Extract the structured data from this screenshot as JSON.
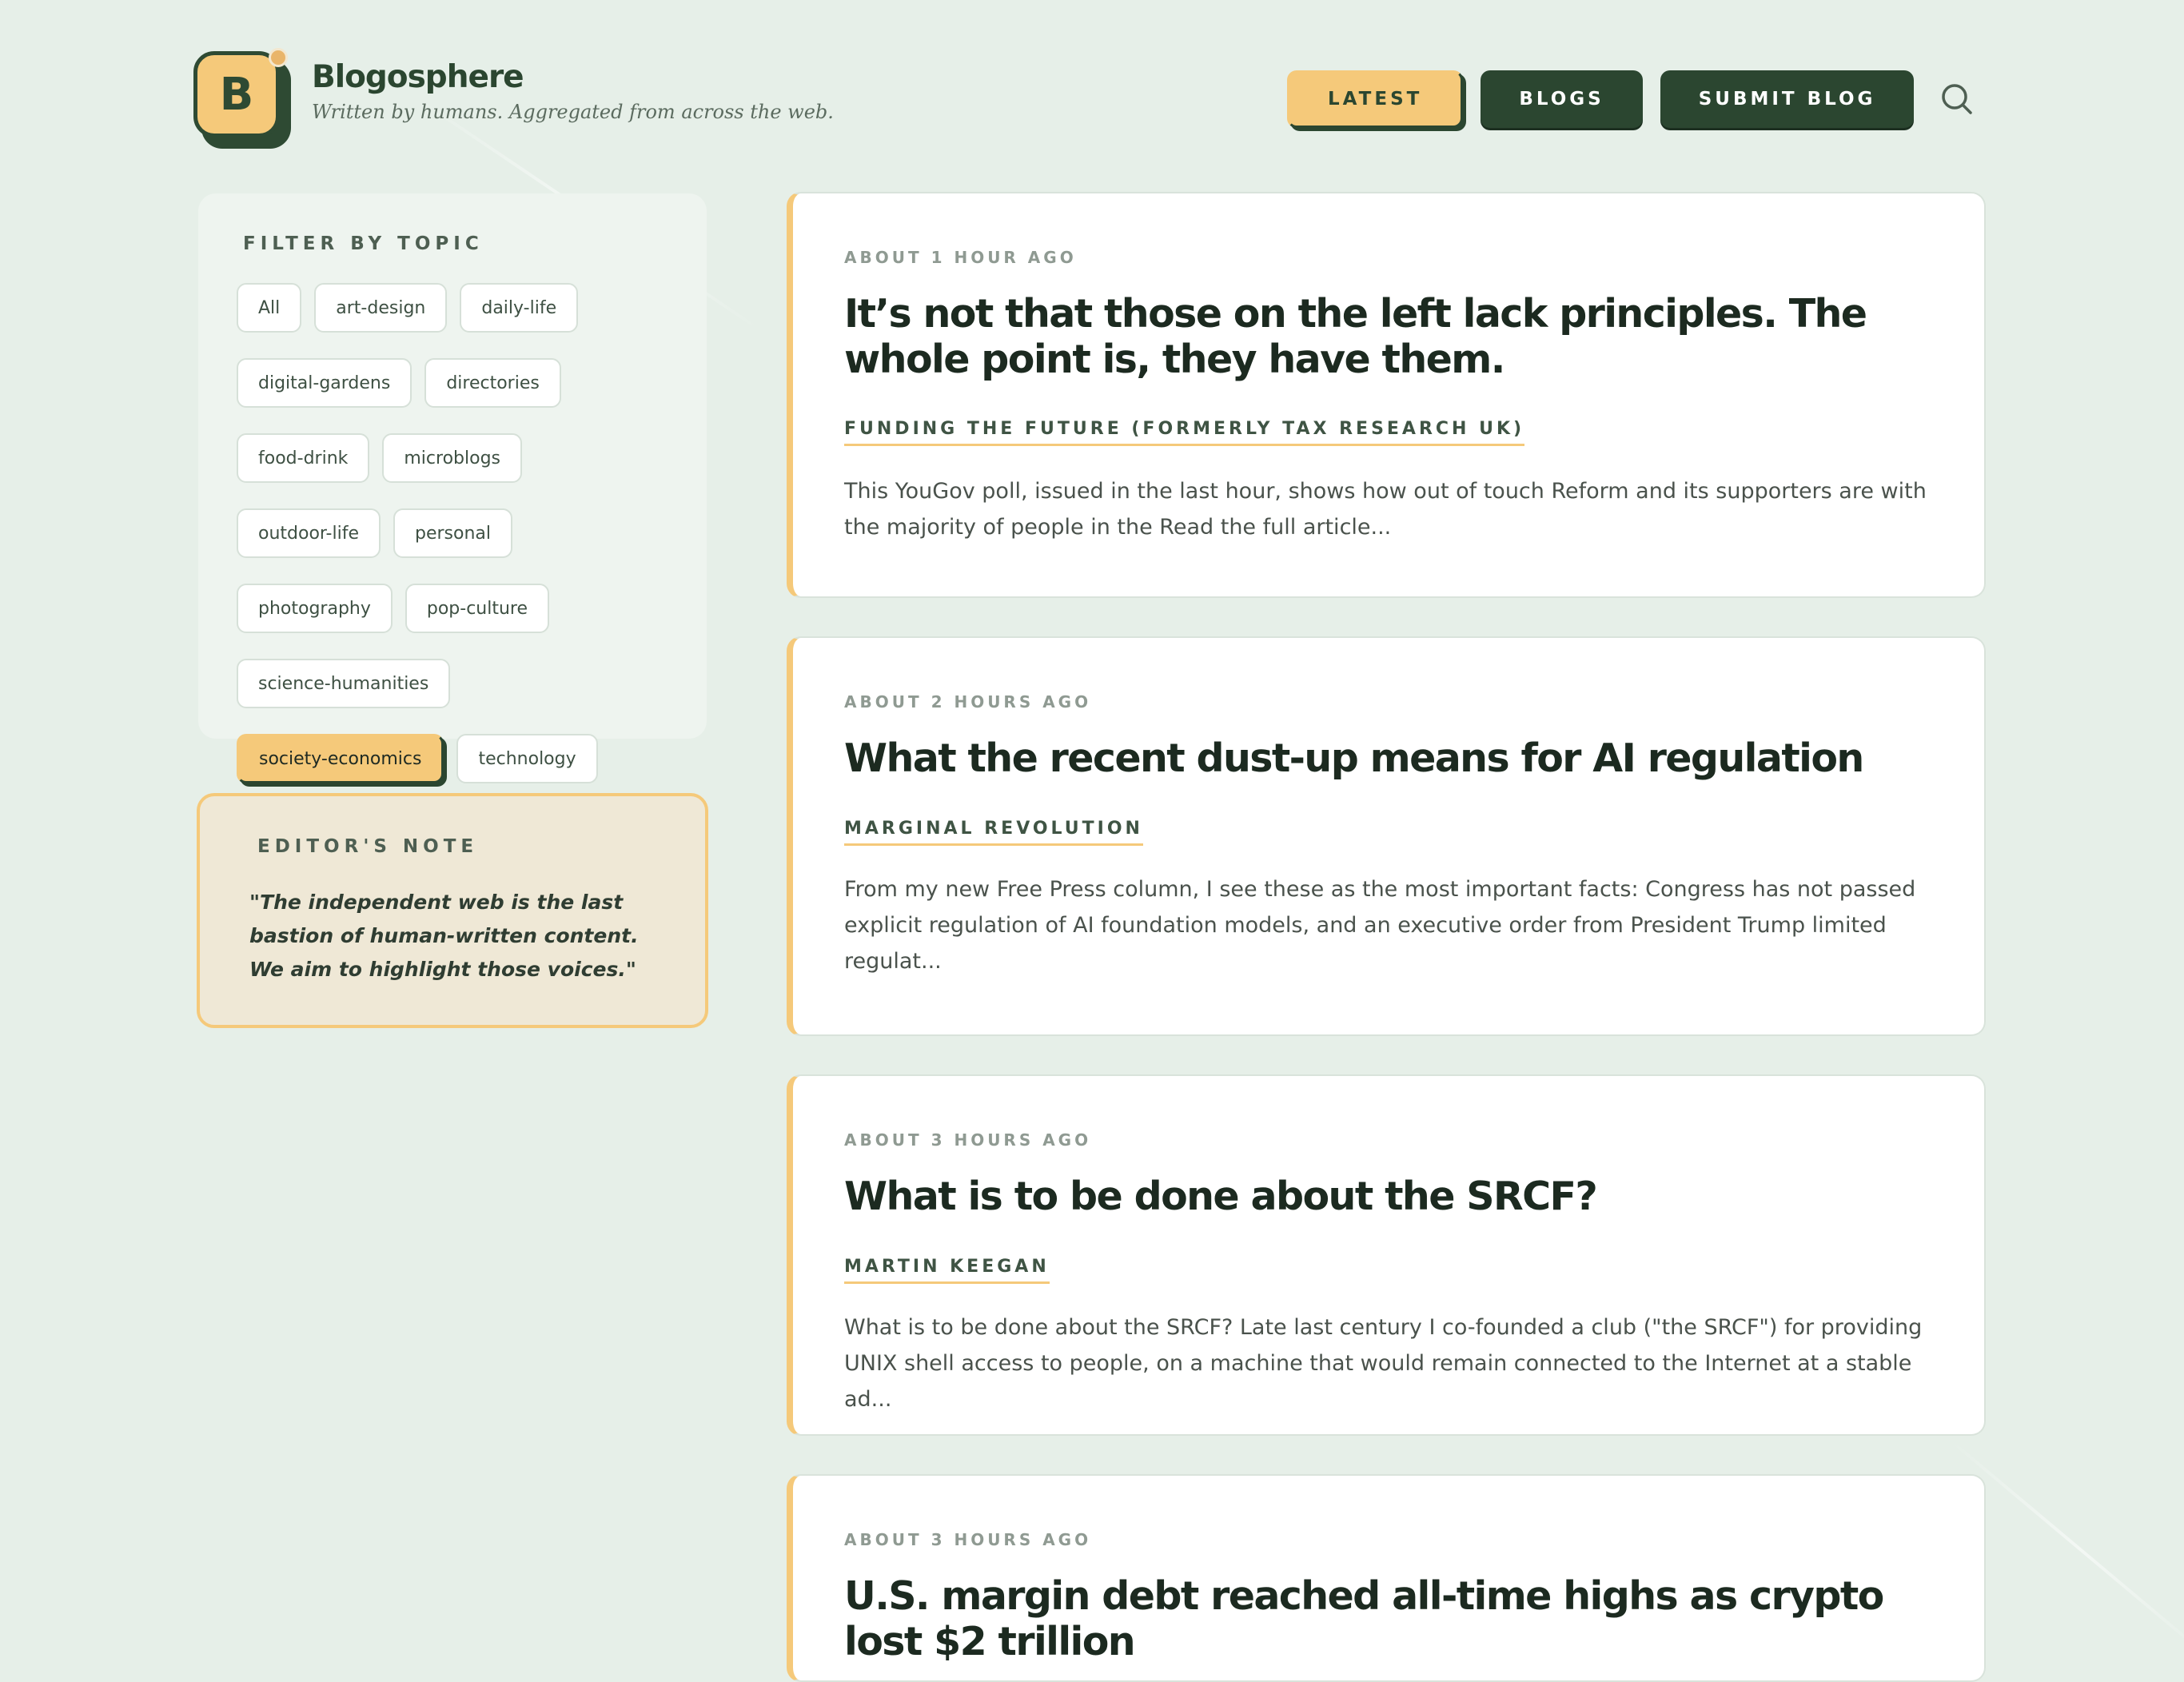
{
  "site": {
    "logo_letter": "B",
    "title": "Blogosphere",
    "tagline": "Written by humans. Aggregated from across the web."
  },
  "nav": {
    "latest": "LATEST",
    "blogs": "BLOGS",
    "submit": "SUBMIT BLOG",
    "search_icon": "search-icon"
  },
  "filter": {
    "heading": "FILTER BY TOPIC",
    "tags": [
      "All",
      "art-design",
      "daily-life",
      "digital-gardens",
      "directories",
      "food-drink",
      "microblogs",
      "outdoor-life",
      "personal",
      "photography",
      "pop-culture",
      "science-humanities",
      "society-economics",
      "technology"
    ],
    "selected": "society-economics"
  },
  "editor_note": {
    "heading": "EDITOR'S NOTE",
    "quote": "\"The independent web is the last bastion of human-written content. We aim to highlight those voices.\""
  },
  "posts": [
    {
      "time": "ABOUT 1 HOUR AGO",
      "title": "It’s not that those on the left lack principles. The whole point is, they have them.",
      "source": "FUNDING THE FUTURE (FORMERLY TAX RESEARCH UK)",
      "excerpt": "This YouGov poll, issued in the last hour, shows how out of touch Reform and its supporters are with the majority of people in the Read the full article..."
    },
    {
      "time": "ABOUT 2 HOURS AGO",
      "title": "What the recent dust-up means for AI regulation",
      "source": "MARGINAL REVOLUTION",
      "excerpt": "From my new Free Press column, I see these as the most important facts: Congress has not passed explicit regulation of AI foundation models, and an executive order from President Trump limited regulat..."
    },
    {
      "time": "ABOUT 3 HOURS AGO",
      "title": "What is to be done about the SRCF?",
      "source": "MARTIN KEEGAN",
      "excerpt": "What is to be done about the SRCF? Late last century I co-founded a club (\"the SRCF\") for providing UNIX shell access to people, on a machine that would remain connected to the Internet at a stable ad..."
    },
    {
      "time": "ABOUT 3 HOURS AGO",
      "title": "U.S. margin debt reached all-time highs as crypto lost $2 trillion",
      "source": "",
      "excerpt": ""
    }
  ],
  "colors": {
    "background": "#e6efe8",
    "accent": "#f5c97a",
    "dark_green": "#2b4630",
    "card": "#ffffff"
  }
}
